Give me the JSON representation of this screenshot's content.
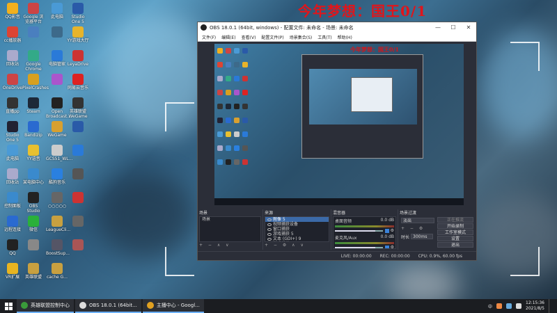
{
  "wallpaper": {
    "overlay_text": "今年梦想：国王0/1",
    "accent_color": "#e0151b"
  },
  "desktop_icons": [
    {
      "label": "QQ影音",
      "color": "#f2b01e"
    },
    {
      "label": "Google 浏览器平台",
      "color": "#c44"
    },
    {
      "label": "此电脑",
      "color": "#4a9ad6"
    },
    {
      "label": "Studio One 5",
      "color": "#2a5aa8"
    },
    {
      "label": "cc播放器",
      "color": "#d43"
    },
    {
      "label": "",
      "color": "#4a7fbf"
    },
    {
      "label": "",
      "color": "#3d6a8a"
    },
    {
      "label": "YY游戏大厅",
      "color": "#e8b42a"
    },
    {
      "label": "回收站",
      "color": "#aac"
    },
    {
      "label": "Google Chrome",
      "color": "#3a8"
    },
    {
      "label": "电脑管家",
      "color": "#2a7ad8"
    },
    {
      "label": "LeyaDrive",
      "color": "#c33"
    },
    {
      "label": "OneDrive",
      "color": "#c44"
    },
    {
      "label": "PixelCrashes",
      "color": "#d8a020"
    },
    {
      "label": "",
      "color": "#a5c"
    },
    {
      "label": "网易云音乐",
      "color": "#d22"
    },
    {
      "label": "直播pp",
      "color": "#333"
    },
    {
      "label": "Steam",
      "color": "#1d2838"
    },
    {
      "label": "Open Broadcast...",
      "color": "#222"
    },
    {
      "label": "英雄联盟WeGame",
      "color": "#333"
    },
    {
      "label": "Studio One 5",
      "color": "#223"
    },
    {
      "label": "Bandizip",
      "color": "#2a6ad0"
    },
    {
      "label": "WeGame",
      "color": "#d8a030"
    },
    {
      "label": "",
      "color": "#2a5aa8"
    },
    {
      "label": "此电脑",
      "color": "#4a9ad6"
    },
    {
      "label": "YY语音",
      "color": "#e8c030"
    },
    {
      "label": "GCS51_WL...",
      "color": "#ccc"
    },
    {
      "label": "",
      "color": "#2a7ad8"
    },
    {
      "label": "回收站",
      "color": "#aac"
    },
    {
      "label": "某电脑中心",
      "color": "#3a8acd"
    },
    {
      "label": "酷狗音乐",
      "color": "#2a80e0"
    },
    {
      "label": "",
      "color": "#555"
    },
    {
      "label": "控制面板",
      "color": "#3a8acd"
    },
    {
      "label": "OBS Studio",
      "color": "#222"
    },
    {
      "label": "○○○○○",
      "color": "#666"
    },
    {
      "label": "",
      "color": "#c33"
    },
    {
      "label": "远程连接",
      "color": "#2a6ad0"
    },
    {
      "label": "微信",
      "color": "#2ab03a"
    },
    {
      "label": "LeagueCli...",
      "color": "#c8a040"
    },
    {
      "label": "",
      "color": "#666"
    },
    {
      "label": "QQ",
      "color": "#222"
    },
    {
      "label": "",
      "color": "#888"
    },
    {
      "label": "BoostSup...",
      "color": "#556"
    },
    {
      "label": "",
      "color": "#a55"
    },
    {
      "label": "VR扩展",
      "color": "#e8b420"
    },
    {
      "label": "英雄联盟",
      "color": "#c8a040"
    },
    {
      "label": "cache G...",
      "color": "#c8a040"
    }
  ],
  "obs": {
    "title": "OBS 18.0.1 (64bit, windows) - 配置文件: 未命名 - 场景: 未命名",
    "window_controls": {
      "minimize": "—",
      "maximize": "☐",
      "close": "✕"
    },
    "menu": [
      "文件(F)",
      "编辑(E)",
      "查看(V)",
      "配置文件(P)",
      "场景集合(S)",
      "工具(T)",
      "帮助(H)"
    ],
    "preview_text": "今年梦想：国王0/1",
    "scenes": {
      "header": "场景",
      "items": [
        "场景"
      ],
      "footer": "+ − ∧ ∨"
    },
    "sources": {
      "header": "来源",
      "items": [
        "图像 5",
        "视频捕获设备",
        "窗口捕获",
        "游戏捕获 5",
        "文本 (GDI+) 9",
        "游戏捕获 8",
        "游戏捕获 6",
        "游戏捕获 6",
        "游戏捕获 4"
      ],
      "footer": "+ − ⚙ ∧ ∨"
    },
    "mixer": {
      "header": "混音器",
      "channels": [
        {
          "name": "桌面音频",
          "db": "0.0 dB",
          "level": 0.85
        },
        {
          "name": "麦克风/Aux",
          "db": "0.0 dB",
          "level": 0.85
        }
      ]
    },
    "transitions": {
      "header": "场景过渡",
      "type": "淡出",
      "duration_label": "时长",
      "duration_value": "300ms"
    },
    "controls": {
      "buttons": [
        {
          "label": "正在推流",
          "disabled": true
        },
        {
          "label": "开始录制",
          "disabled": false
        },
        {
          "label": "工作室模式",
          "disabled": false
        },
        {
          "label": "设置",
          "disabled": false
        },
        {
          "label": "退出",
          "disabled": false
        }
      ]
    },
    "status": {
      "live": "LIVE: 00:00:00",
      "rec": "REC: 00:00:00",
      "cpu": "CPU: 0.9%, 60.00 fps"
    }
  },
  "taskbar": {
    "buttons": [
      {
        "label": "英雄联盟控制中心",
        "color": "#3a9a3a"
      },
      {
        "label": "OBS 18.0.1 (64bit...",
        "color": "#ddd"
      },
      {
        "label": "主播中心 - Googl...",
        "color": "#e0a020"
      }
    ],
    "tray_text": "中",
    "time": "12:15:36",
    "date": "2021/8/5"
  }
}
